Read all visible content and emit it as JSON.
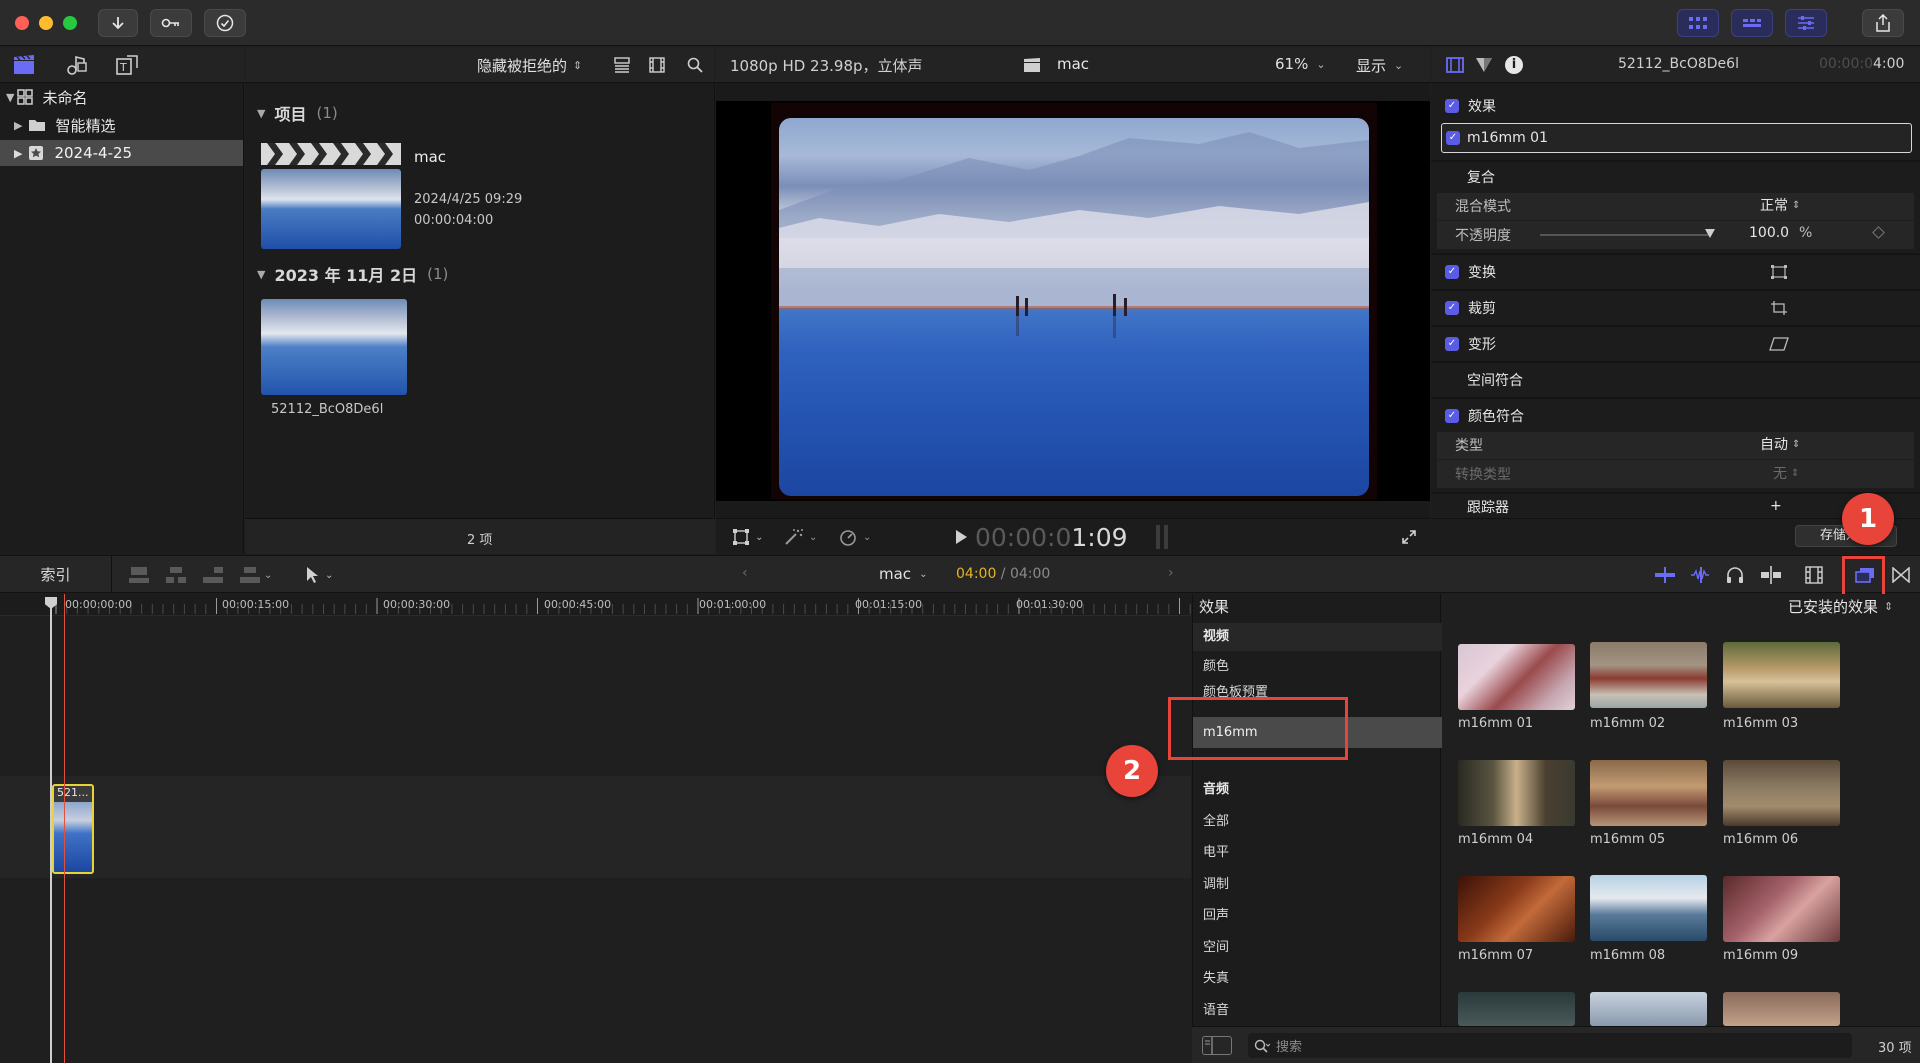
{
  "window": {
    "toolbar": {
      "import_icon": "download-icon",
      "keyword_icon": "key-icon",
      "bg_task_icon": "checkmark-circle-icon",
      "share_icon": "share-icon"
    }
  },
  "browser": {
    "filter_label": "隐藏被拒绝的",
    "library": {
      "name": "未命名",
      "items": [
        {
          "label": "智能精选"
        },
        {
          "label": "2024-4-25"
        }
      ]
    },
    "sections": [
      {
        "title": "项目",
        "count": "(1)"
      },
      {
        "title": "2023 年 11月 2日",
        "count": "(1)"
      }
    ],
    "project": {
      "name": "mac",
      "date": "2024/4/25 09:29",
      "duration": "00:00:04:00"
    },
    "clip": {
      "name": "52112_BcO8De6l"
    },
    "footer_count": "2 项"
  },
  "viewer": {
    "format": "1080p HD 23.98p，立体声",
    "project_name": "mac",
    "zoom": "61%",
    "display_label": "显示",
    "timecode_dim": "00:00:0",
    "timecode_bright": "1:09"
  },
  "inspector": {
    "clip_name": "52112_BcO8De6l",
    "duration_dim": "00:00:0",
    "duration_bright": "4:00",
    "sections": {
      "effects": "效果",
      "effect_name": "m16mm 01",
      "composite": "复合",
      "blend_mode_label": "混合模式",
      "blend_mode_value": "正常",
      "opacity_label": "不透明度",
      "opacity_value": "100.0",
      "opacity_unit": "%",
      "transform": "变换",
      "crop": "裁剪",
      "distort": "变形",
      "spatial_conform": "空间符合",
      "color_conform": "颜色符合",
      "type_label": "类型",
      "type_value": "自动",
      "convert_label": "转换类型",
      "convert_value": "无",
      "tracker": "跟踪器",
      "tracker_add": "+"
    },
    "save_effects": "存储效果"
  },
  "timeline": {
    "index_label": "索引",
    "project_name": "mac",
    "time_current": "04:00",
    "time_sep": " / ",
    "time_total": "04:00",
    "ruler": [
      "00:00:00:00",
      "00:00:15:00",
      "00:00:30:00",
      "00:00:45:00",
      "00:01:00:00",
      "00:01:15:00",
      "00:01:30:00"
    ],
    "clip_label": "521..."
  },
  "effects_browser": {
    "title": "效果",
    "installed_label": "已安装的效果",
    "categories": [
      {
        "label": "视频",
        "bold": true
      },
      {
        "label": "颜色"
      },
      {
        "label": "颜色板预置"
      },
      {
        "label": "m16mm",
        "selected": true
      },
      {
        "label": "音频",
        "bold": true
      },
      {
        "label": "全部"
      },
      {
        "label": "电平"
      },
      {
        "label": "调制"
      },
      {
        "label": "回声"
      },
      {
        "label": "空间"
      },
      {
        "label": "失真"
      },
      {
        "label": "语音"
      }
    ],
    "effects": [
      {
        "name": "m16mm 01"
      },
      {
        "name": "m16mm 02"
      },
      {
        "name": "m16mm 03"
      },
      {
        "name": "m16mm 04"
      },
      {
        "name": "m16mm 05"
      },
      {
        "name": "m16mm 06"
      },
      {
        "name": "m16mm 07"
      },
      {
        "name": "m16mm 08"
      },
      {
        "name": "m16mm 09"
      }
    ],
    "search_placeholder": "搜索",
    "count": "30 项"
  },
  "annotations": [
    "1",
    "2"
  ],
  "colors": {
    "accent": "#5a5ce6",
    "annotation_red": "#e8443a",
    "timecode_yellow": "#e6b422",
    "playhead": "#e0503c"
  }
}
